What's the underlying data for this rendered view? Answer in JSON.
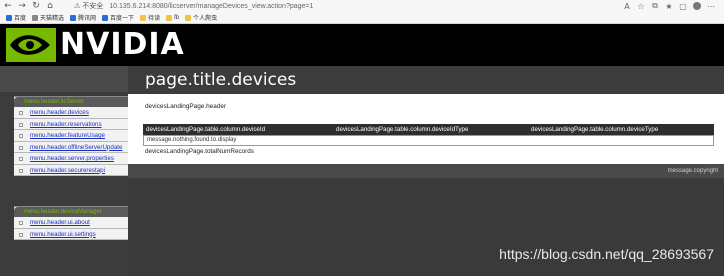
{
  "browser": {
    "insecure_label": "不安全",
    "url": "10.135.6.214:8080/licserver/manageDevices_view.action?page=1",
    "bookmarks": [
      {
        "label": "百度",
        "icon": "blue-square-icon"
      },
      {
        "label": "天猫精选",
        "icon": "bookmark-icon"
      },
      {
        "label": "腾讯网",
        "icon": "bookmark-icon"
      },
      {
        "label": "百度一下",
        "icon": "bookmark-icon"
      },
      {
        "label": "待读",
        "icon": "folder-icon"
      },
      {
        "label": "fb",
        "icon": "folder-icon"
      },
      {
        "label": "个人爬虫",
        "icon": "folder-icon"
      }
    ]
  },
  "brand": {
    "name": "NVIDIA",
    "colors": {
      "green": "#76b900",
      "black": "#000000"
    }
  },
  "page": {
    "title": "page.title.devices"
  },
  "menus": [
    {
      "header": "menu.header.licServer",
      "items": [
        "menu.header.devices",
        "menu.header.reservations",
        "menu.header.featureUsage",
        "menu.header.offlineServerUpdate",
        "menu.header.server.properties",
        "menu.header.securerestapi"
      ]
    },
    {
      "header": "menu.header.deviceManager",
      "items": [
        "menu.header.ui.about",
        "menu.header.ui.settings"
      ]
    }
  ],
  "landing": {
    "header": "devicesLandingPage.header",
    "columns": [
      "devicesLandingPage.table.column.deviceId",
      "devicesLandingPage.table.column.deviceIdType",
      "devicesLandingPage.table.column.deviceType"
    ],
    "empty_message": "message.nothing.found.to.display",
    "total": "devicesLandingPage.totalNumRecords"
  },
  "footer": {
    "copyright": "message.copyright"
  },
  "watermark": "https://blog.csdn.net/qq_28693567"
}
